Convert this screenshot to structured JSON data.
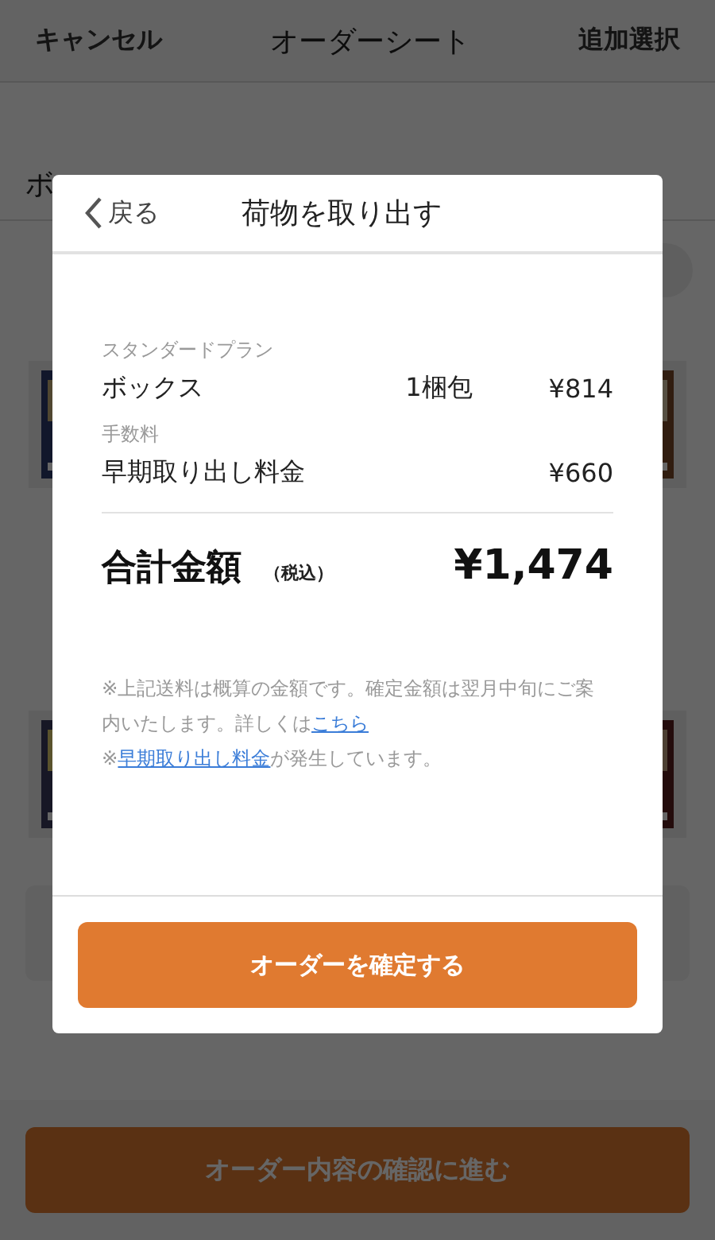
{
  "header": {
    "cancel": "キャンセル",
    "title": "オーダーシート",
    "add": "追加選択"
  },
  "section_label": "ボ",
  "modal": {
    "back": "戻る",
    "title": "荷物を取り出す",
    "groups": [
      {
        "category": "スタンダードプラン",
        "name": "ボックス",
        "quantity": "1梱包",
        "price": "¥814"
      },
      {
        "category": "手数料",
        "name": "早期取り出し料金",
        "price": "¥660"
      }
    ],
    "total": {
      "label": "合計金額",
      "tax_note": "（税込）",
      "amount": "¥1,474"
    },
    "notes": [
      [
        {
          "text": "※上記送料は概算の金額です。確定金額は翌月中旬にご案内いたします。詳しくは",
          "link": false
        },
        {
          "text": "こちら",
          "link": true
        }
      ],
      [
        {
          "text": "※",
          "link": false
        },
        {
          "text": "早期取り出し料金",
          "link": true
        },
        {
          "text": "が発生しています。",
          "link": false
        }
      ]
    ],
    "confirm_button": "オーダーを確定する"
  },
  "bottom_button": "オーダー内容の確認に進む"
}
